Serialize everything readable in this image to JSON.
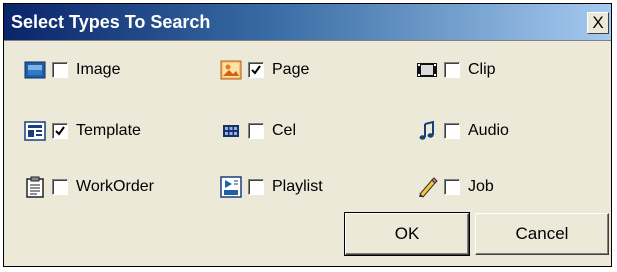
{
  "dialog": {
    "title": "Select Types To Search",
    "close_label": "X"
  },
  "types": [
    {
      "id": "image",
      "label": "Image",
      "checked": false,
      "icon": "image-icon"
    },
    {
      "id": "page",
      "label": "Page",
      "checked": true,
      "icon": "page-icon"
    },
    {
      "id": "clip",
      "label": "Clip",
      "checked": false,
      "icon": "clip-icon"
    },
    {
      "id": "template",
      "label": "Template",
      "checked": true,
      "icon": "template-icon"
    },
    {
      "id": "cel",
      "label": "Cel",
      "checked": false,
      "icon": "cel-icon"
    },
    {
      "id": "audio",
      "label": "Audio",
      "checked": false,
      "icon": "audio-icon"
    },
    {
      "id": "workorder",
      "label": "WorkOrder",
      "checked": false,
      "icon": "workorder-icon"
    },
    {
      "id": "playlist",
      "label": "Playlist",
      "checked": false,
      "icon": "playlist-icon"
    },
    {
      "id": "job",
      "label": "Job",
      "checked": false,
      "icon": "job-icon"
    }
  ],
  "buttons": {
    "ok_label": "OK",
    "cancel_label": "Cancel"
  }
}
